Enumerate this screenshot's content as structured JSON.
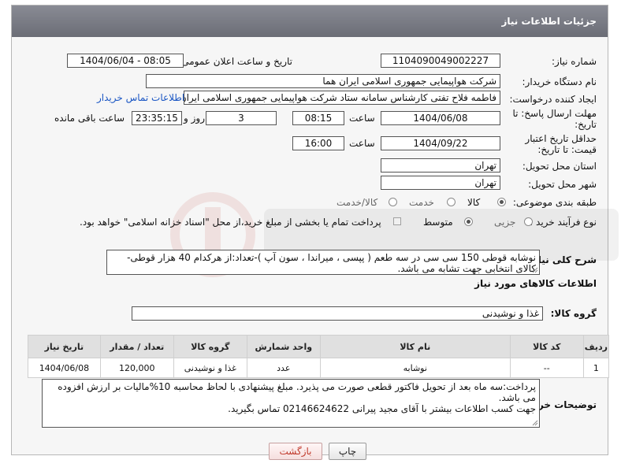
{
  "header": {
    "title": "جزئیات اطلاعات نیاز"
  },
  "fields": {
    "need_number_label": "شماره نیاز:",
    "need_number": "1104090049002227",
    "announce_label": "تاریخ و ساعت اعلان عمومی:",
    "announce_value": "1404/06/04 - 08:05",
    "buyer_org_label": "نام دستگاه خریدار:",
    "buyer_org": "شرکت هواپیمایی جمهوری اسلامی ایران هما",
    "creator_label": "ایجاد کننده درخواست:",
    "creator": "فاطمه فلاح تفتی کارشناس سامانه ستاد شرکت هواپیمایی جمهوری اسلامی ایران هما",
    "buyer_contact_link": "اطلاعات تماس خریدار",
    "deadline_label": "مهلت ارسال پاسخ: تا تاریخ:",
    "deadline_date": "1404/06/08",
    "time_label": "ساعت",
    "deadline_time": "08:15",
    "days_value": "3",
    "days_label": "روز و",
    "remaining_time": "23:35:15",
    "remaining_label": "ساعت باقی مانده",
    "price_valid_label": "حداقل تاریخ اعتبار قیمت: تا تاریخ:",
    "price_valid_date": "1404/09/22",
    "price_valid_time": "16:00",
    "province_label": "استان محل تحویل:",
    "province": "تهران",
    "city_label": "شهر محل تحویل:",
    "city": "تهران",
    "category_label": "طبقه بندی موضوعی:",
    "category_options": [
      "کالا",
      "خدمت",
      "کالا/خدمت"
    ],
    "purchase_type_label": "نوع فرآیند خرید :",
    "purchase_type_options": [
      "جزیی",
      "متوسط"
    ],
    "treasury_note": "پرداخت تمام یا بخشی از مبلغ خرید،از محل \"اسناد خزانه اسلامی\" خواهد بود.",
    "general_desc_label": "شرح کلی نیاز:",
    "general_desc": "نوشابه قوطی 150 سی سی در سه طعم ( پپسی ، میراندا ، سون آپ )-تعداد:از هرکدام 40 هزار قوطی-کالای انتخابی جهت تشابه می باشد.",
    "goods_info_title": "اطلاعات کالاهای مورد نیاز",
    "goods_group_label": "گروه کالا:",
    "goods_group": "غذا و نوشیدنی",
    "buyer_notes_label": "توضیحات خریدار:",
    "buyer_notes_1": "پرداخت:سه ماه بعد از تحویل فاکتور قطعی صورت می پذیرد. مبلغ پیشنهادی با لحاظ محاسبه 10%مالیات بر ارزش افزوده می باشد.",
    "buyer_notes_2": "جهت کسب اطلاعات بیشتر با آقای مجید پیرانی 02146624622 تماس بگیرید."
  },
  "table": {
    "headers": [
      "ردیف",
      "کد کالا",
      "نام کالا",
      "واحد شمارش",
      "گروه کالا",
      "تعداد / مقدار",
      "تاریخ نیاز"
    ],
    "rows": [
      [
        "1",
        "--",
        "نوشابه",
        "عدد",
        "غذا و نوشیدنی",
        "120,000",
        "1404/06/08"
      ]
    ]
  },
  "buttons": {
    "print": "چاپ",
    "back": "بازگشت"
  },
  "colors": {
    "header_bg": "#7a7c85",
    "link": "#1a56c4",
    "back_text": "#c0392b"
  }
}
